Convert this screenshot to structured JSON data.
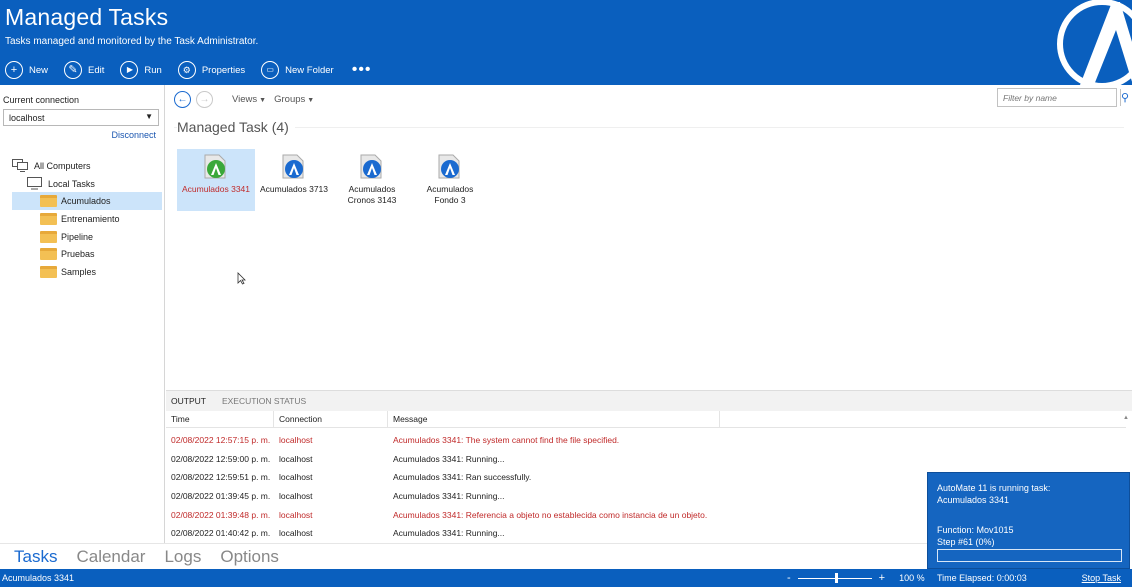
{
  "header": {
    "title": "Managed Tasks",
    "subtitle": "Tasks managed and monitored by the Task Administrator.",
    "toolbar": [
      {
        "label": "New",
        "icon": "plus-icon"
      },
      {
        "label": "Edit",
        "icon": "pencil-icon"
      },
      {
        "label": "Run",
        "icon": "play-icon"
      },
      {
        "label": "Properties",
        "icon": "properties-icon"
      },
      {
        "label": "New Folder",
        "icon": "new-folder-icon"
      }
    ],
    "more": "•••",
    "colors": {
      "primary": "#0a5fbe",
      "selection": "#cce4fa",
      "error": "#c02a2a"
    }
  },
  "left": {
    "connection_label": "Current connection",
    "connection_value": "localhost",
    "disconnect": "Disconnect",
    "tree": [
      {
        "label": "All Computers",
        "icon": "computers-icon"
      },
      {
        "label": "Local Tasks",
        "icon": "computer-icon"
      },
      {
        "label": "Acumulados",
        "icon": "folder-icon"
      },
      {
        "label": "Entrenamiento",
        "icon": "folder-icon"
      },
      {
        "label": "Pipeline",
        "icon": "folder-icon"
      },
      {
        "label": "Pruebas",
        "icon": "folder-icon"
      },
      {
        "label": "Samples",
        "icon": "folder-icon"
      }
    ]
  },
  "main": {
    "views": "Views",
    "groups": "Groups",
    "filter_placeholder": "Filter by name",
    "section_title": "Managed Task (4)",
    "tasks": [
      {
        "line1": "Acumulados 3341",
        "line2": ""
      },
      {
        "line1": "Acumulados 3713",
        "line2": ""
      },
      {
        "line1": "Acumulados",
        "line2": "Cronos 3143"
      },
      {
        "line1": "Acumulados",
        "line2": "Fondo 3"
      }
    ]
  },
  "output": {
    "tabs": [
      "OUTPUT",
      "EXECUTION STATUS"
    ],
    "columns": [
      "Time",
      "Connection",
      "Message"
    ],
    "rows": [
      {
        "time": "02/08/2022 12:57:15 p. m.",
        "connection": "localhost",
        "message": "Acumulados 3341: The system cannot find the file specified.",
        "error": true
      },
      {
        "time": "02/08/2022 12:59:00 p. m.",
        "connection": "localhost",
        "message": "Acumulados 3341: Running...",
        "error": false
      },
      {
        "time": "02/08/2022 12:59:51 p. m.",
        "connection": "localhost",
        "message": "Acumulados 3341: Ran successfully.",
        "error": false
      },
      {
        "time": "02/08/2022 01:39:45 p. m.",
        "connection": "localhost",
        "message": "Acumulados 3341: Running...",
        "error": false
      },
      {
        "time": "02/08/2022 01:39:48 p. m.",
        "connection": "localhost",
        "message": "Acumulados 3341: Referencia a objeto no establecida como instancia de un objeto.",
        "error": true
      },
      {
        "time": "02/08/2022 01:40:42 p. m.",
        "connection": "localhost",
        "message": "Acumulados 3341: Running...",
        "error": false
      }
    ]
  },
  "notification": {
    "line1": "AutoMate 11 is running task:",
    "line2": "Acumulados 3341",
    "function": "Function: Mov1015",
    "step": "Step #61 (0%)",
    "progress": 0
  },
  "bottomnav": [
    "Tasks",
    "Calendar",
    "Logs",
    "Options"
  ],
  "statusbar": {
    "left": "Acumulados 3341",
    "zoom_minus": "-",
    "zoom_plus": "+",
    "zoom": "100 %",
    "zoom_level": 0.5,
    "elapsed": "Time Elapsed: 0:00:03",
    "stop": "Stop Task"
  }
}
